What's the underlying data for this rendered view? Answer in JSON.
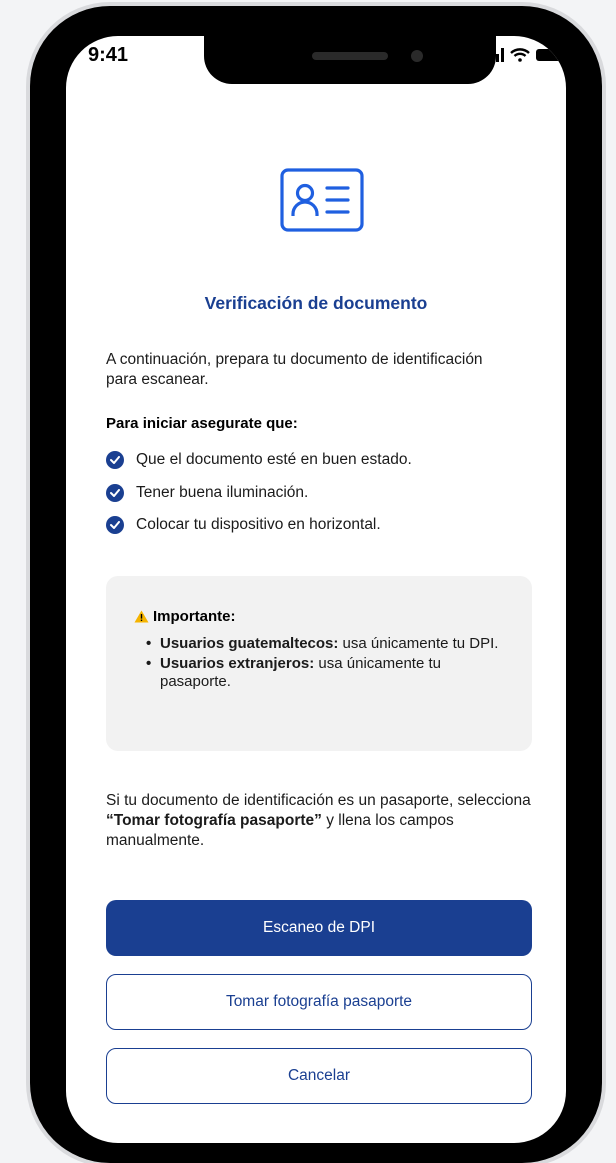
{
  "status_bar": {
    "time": "9:41"
  },
  "header": {
    "title": "Verificación de documento"
  },
  "intro": {
    "text": "A continuación, prepara tu documento de identificación para escanear."
  },
  "checklist": {
    "heading": "Para iniciar asegurate que:",
    "items": [
      "Que el documento esté en buen estado.",
      "Tener buena iluminación.",
      "Colocar tu dispositivo en horizontal."
    ]
  },
  "notice": {
    "heading": "Importante:",
    "items": [
      {
        "bold": "Usuarios guatemaltecos:",
        "text": " usa únicamente tu DPI."
      },
      {
        "bold": "Usuarios extranjeros:",
        "text": " usa únicamente tu pasaporte."
      }
    ]
  },
  "passport_note": {
    "before": "Si tu documento de identificación es un pasaporte, selecciona ",
    "bold": "“Tomar fotografía pasaporte”",
    "after": " y llena los campos manualmente."
  },
  "buttons": {
    "scan_dpi": "Escaneo de DPI",
    "passport_photo": "Tomar fotografía pasaporte",
    "cancel": "Cancelar"
  },
  "colors": {
    "brand": "#1a3f91",
    "warning": "#f5b400",
    "notice_bg": "#f2f2f2"
  },
  "icons": {
    "document": "id-card-icon",
    "check": "check-circle-icon",
    "warning": "warning-icon"
  }
}
